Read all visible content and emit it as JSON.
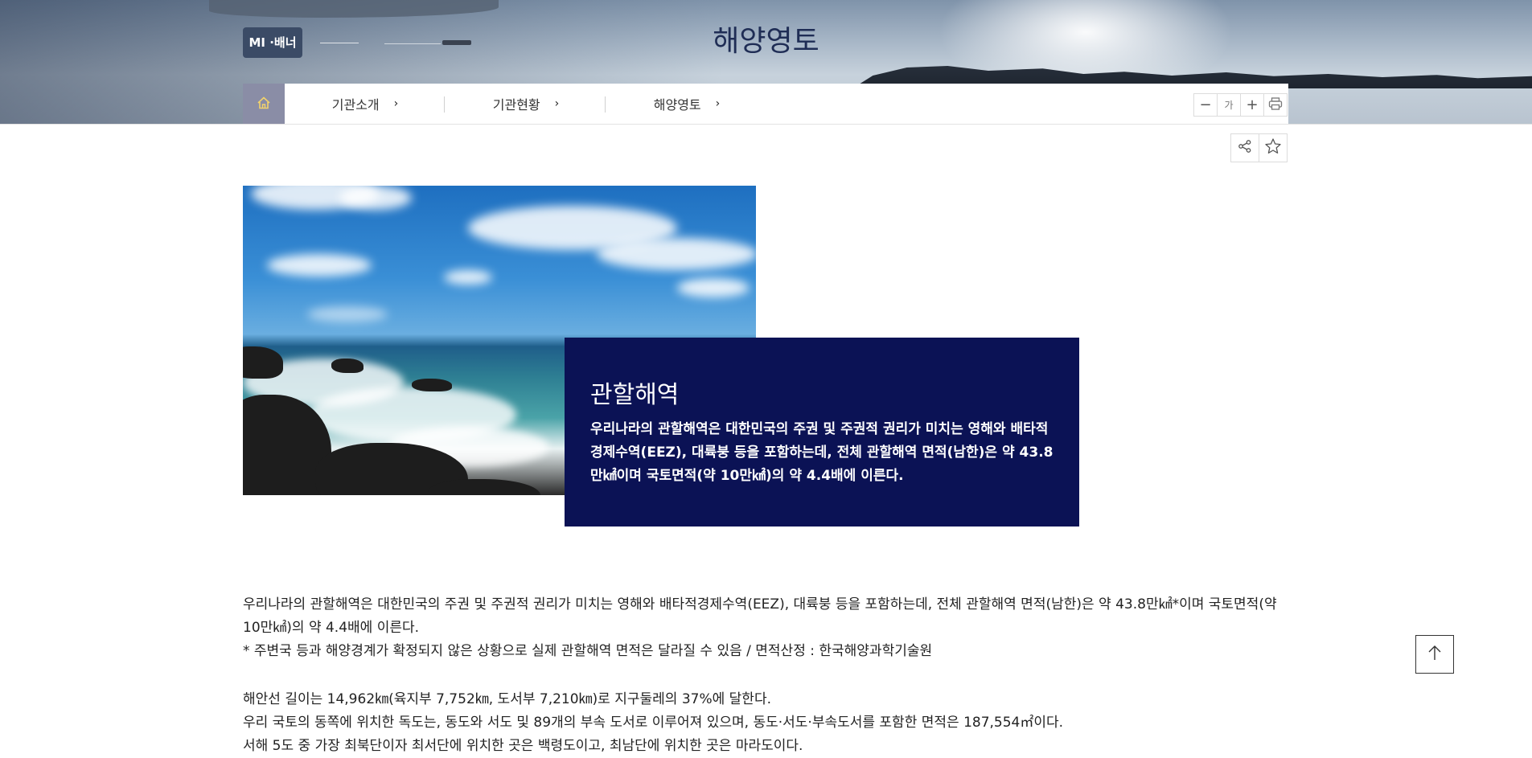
{
  "header": {
    "badge_label": "MI ·배너",
    "page_title": "해양영토"
  },
  "nav": {
    "home_icon": "home-icon",
    "items": [
      {
        "label": "기관소개"
      },
      {
        "label": "기관현황"
      },
      {
        "label": "해양영토"
      }
    ],
    "tools": {
      "font_decrease": "−",
      "font_label": "가",
      "font_increase": "+",
      "print_icon": "print-icon"
    }
  },
  "utilities": {
    "share_icon": "share-icon",
    "bookmark_icon": "star-icon"
  },
  "hero": {
    "title": "관할해역",
    "text": "우리나라의 관할해역은 대한민국의 주권 및 주권적 권리가 미치는 영해와 배타적경제수역(EEZ), 대륙붕 등을 포함하는데, 전체 관할해역 면적(남한)은 약 43.8만㎢이며 국토면적(약 10만㎢)의 약 4.4배에 이른다."
  },
  "body": {
    "para1": "우리나라의 관할해역은 대한민국의 주권 및 주권적 권리가 미치는 영해와 배타적경제수역(EEZ), 대륙붕 등을 포함하는데, 전체 관할해역 면적(남한)은 약 43.8만㎢*이며 국토면적(약 10만㎢)의 약 4.4배에 이른다.",
    "note": "* 주변국 등과 해양경계가 확정되지 않은 상황으로 실제 관할해역 면적은 달라질 수 있음 / 면적산정 : 한국해양과학기술원",
    "para2": "해안선 길이는 14,962㎞(육지부 7,752㎞, 도서부 7,210㎞)로 지구둘레의 37%에 달한다.",
    "para3": "우리 국토의 동쪽에 위치한 독도는, 동도와 서도 및 89개의 부속 도서로 이루어져 있으며, 동도·서도·부속도서를 포함한 면적은 187,554㎡이다.",
    "para4": "서해 5도 중 가장 최북단이자 최서단에 위치한 곳은 백령도이고, 최남단에 위치한 곳은 마라도이다."
  },
  "scroll_top_icon": "arrow-up-icon"
}
